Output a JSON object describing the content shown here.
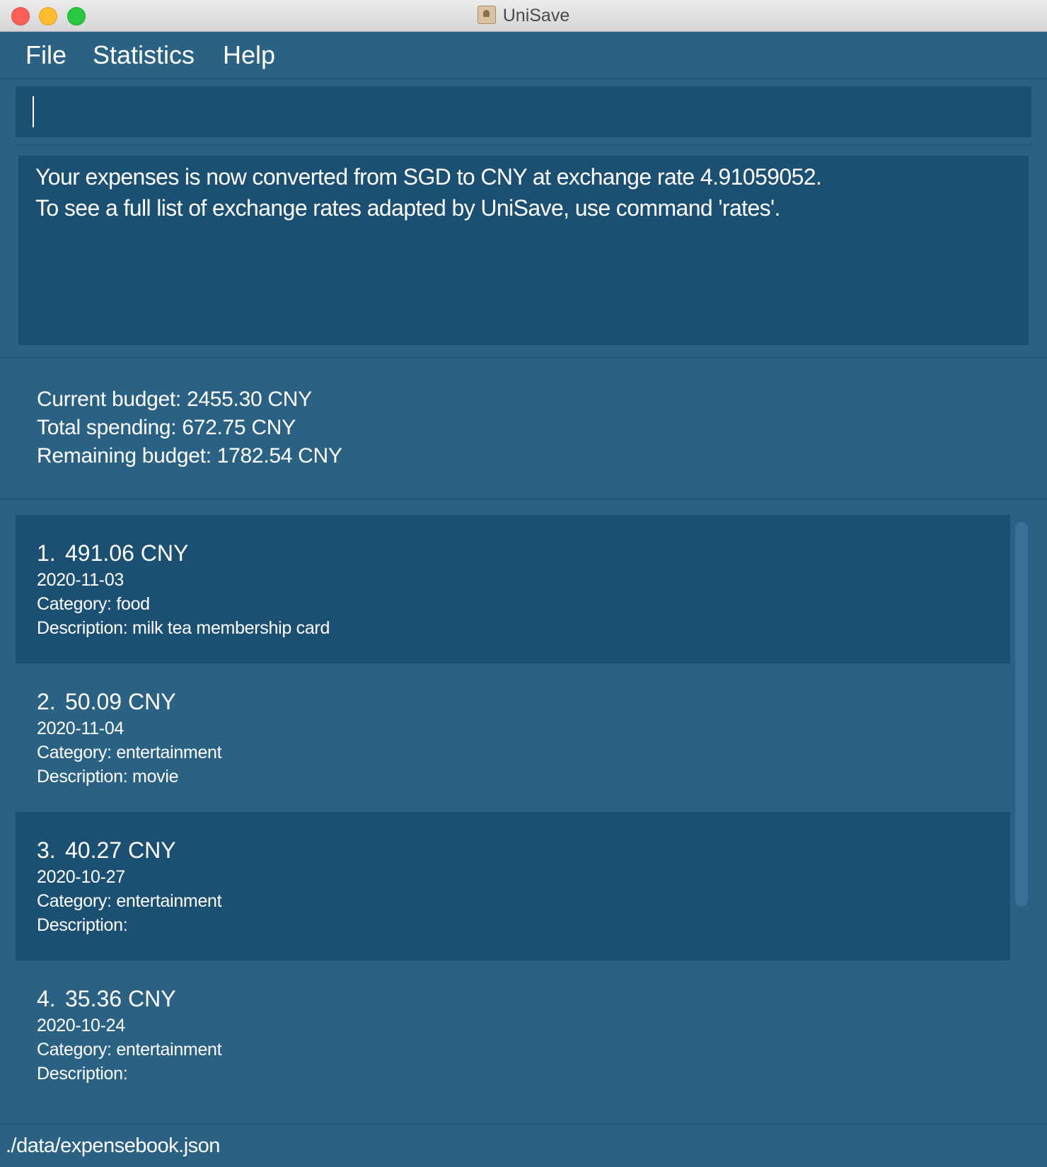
{
  "window": {
    "title": "UniSave"
  },
  "menu": {
    "items": [
      "File",
      "Statistics",
      "Help"
    ]
  },
  "command_box": {
    "value": ""
  },
  "result": {
    "lines": [
      "Your expenses is now converted from SGD to CNY at exchange rate 4.91059052.",
      "To see a full list of exchange rates adapted by UniSave, use command 'rates'."
    ]
  },
  "budget": {
    "current": "Current budget: 2455.30 CNY",
    "total_spending": "Total spending: 672.75 CNY",
    "remaining": "Remaining budget: 1782.54 CNY"
  },
  "expenses": [
    {
      "index": "1.",
      "amount": "491.06 CNY",
      "date": "2020-11-03",
      "category": "Category: food",
      "description": "Description: milk tea membership card"
    },
    {
      "index": "2.",
      "amount": "50.09 CNY",
      "date": "2020-11-04",
      "category": "Category: entertainment",
      "description": "Description: movie"
    },
    {
      "index": "3.",
      "amount": "40.27 CNY",
      "date": "2020-10-27",
      "category": "Category: entertainment",
      "description": "Description:"
    },
    {
      "index": "4.",
      "amount": "35.36 CNY",
      "date": "2020-10-24",
      "category": "Category: entertainment",
      "description": "Description:"
    }
  ],
  "status_bar": {
    "file_path": "./data/expensebook.json"
  },
  "colors": {
    "background": "#2b6284",
    "panel_dark": "#1c5073",
    "text": "#ffffff",
    "close": "#fc5f57",
    "minimize": "#fdbc2e",
    "maximize": "#28c840"
  }
}
